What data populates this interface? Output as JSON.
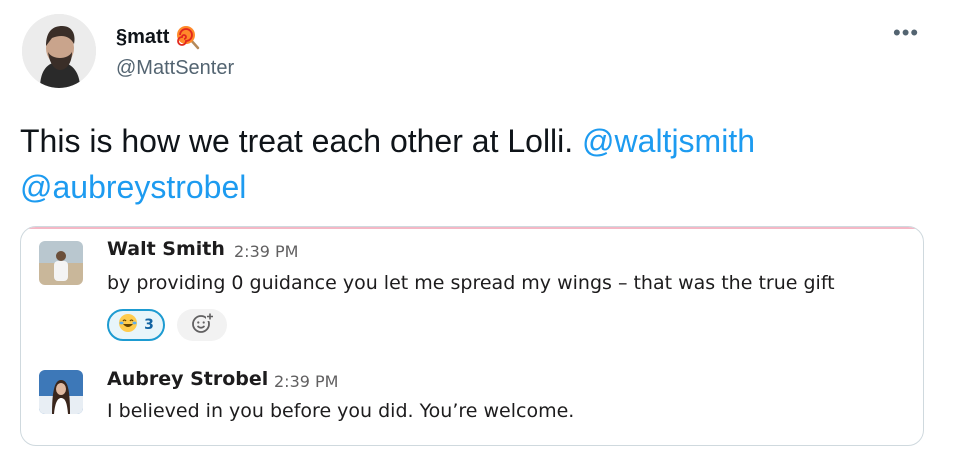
{
  "author": {
    "display_name": "§matt",
    "emoji_icon": "lollipop-icon",
    "handle": "@MattSenter"
  },
  "menu_icon": "more-horizontal-icon",
  "menu_glyph": "•••",
  "tweet": {
    "text_before": "This is how we treat each other at Lolli.",
    "mention_1": "@waltjsmith",
    "mention_2": "@aubreystrobel"
  },
  "embed": {
    "messages": [
      {
        "name": "Walt Smith",
        "time": "2:39 PM",
        "text": "by providing 0 guidance you let me spread my wings – that was the true gift",
        "reaction": {
          "emoji": "joy-emoji-icon",
          "count": "3"
        },
        "add_reaction_icon": "add-emoji-icon"
      },
      {
        "name": "Aubrey Strobel",
        "time": "2:39 PM",
        "text": "I believed in you before you did. You’re welcome."
      }
    ]
  },
  "colors": {
    "mention": "#1d9bf0",
    "secondary_text": "#536471",
    "reaction_border": "#1d9bd1"
  }
}
